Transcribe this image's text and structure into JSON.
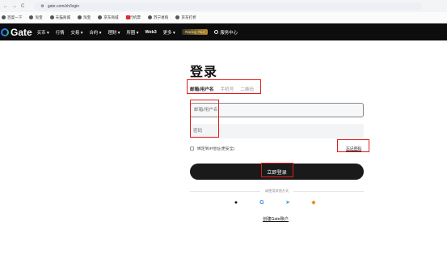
{
  "browser": {
    "nav": [
      "←",
      "→",
      "C"
    ],
    "url": "gate.com/zh/login",
    "bookmarks": [
      "百度一下",
      "淘宝",
      "天猫商城",
      "淘宝",
      "京东商城",
      "旅行机票",
      "苏宁易购",
      "京东打折"
    ]
  },
  "topnav": {
    "logo_text": "Gate",
    "menu": [
      "买币 ▾",
      "行情",
      "交易 ▾",
      "合约 ▾",
      "理财 ▾",
      "所圈 ▾",
      "Web3",
      "更多 ▾"
    ],
    "badge": "Racing Tour",
    "region": "服务中心"
  },
  "login": {
    "title": "登录",
    "tabs": [
      "邮箱/用户名",
      "手机号",
      "二维码"
    ],
    "email_placeholder": "邮箱/用户名",
    "password_placeholder": "密码",
    "remember_label": "绑定到IP地址(更安全)",
    "forgot_label": "忘记密码",
    "login_button": "立即登录",
    "other_methods": "或使用其他方式",
    "social_icons": [
      "apple-icon",
      "google-icon",
      "telegram-icon",
      "metamask-icon"
    ],
    "signup_link": "创建Gate账户"
  }
}
